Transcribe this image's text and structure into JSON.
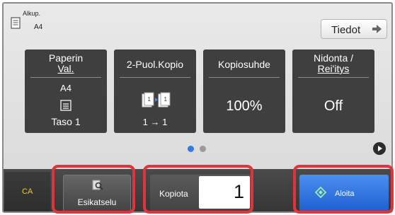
{
  "header": {
    "original_label": "Alkup.",
    "original_size": "A4",
    "original_icon": "original-document-icon",
    "details_button": "Tiedot",
    "details_icon": "arrow-right-icon"
  },
  "tiles": [
    {
      "title_line1": "Paperin",
      "title_line2": "Val.",
      "paper_size": "A4",
      "icon": "paper-tray-icon",
      "tray": "Taso 1"
    },
    {
      "title": "2-Puol.Kopio",
      "icon": "duplex-copy-icon",
      "value": "1 → 1"
    },
    {
      "title": "Kopiosuhde",
      "value": "100%"
    },
    {
      "title_line1": "Nidonta /",
      "title_line2": "Rei'itys",
      "value": "Off"
    }
  ],
  "pagination": {
    "pages": 2,
    "current": 1,
    "next_icon": "next-page-icon"
  },
  "bottom": {
    "ca_label": "CA",
    "preview_label": "Esikatselu",
    "preview_icon": "preview-magnifier-icon",
    "copies_label": "Kopiota",
    "copies_value": "1",
    "start_label": "Aloita",
    "start_icon": "start-diamond-icon"
  },
  "colors": {
    "accent": "#2f7ae5",
    "highlight": "#e0343d",
    "ca_text": "#f2d300",
    "tile_bg": "#3f3f3f"
  }
}
